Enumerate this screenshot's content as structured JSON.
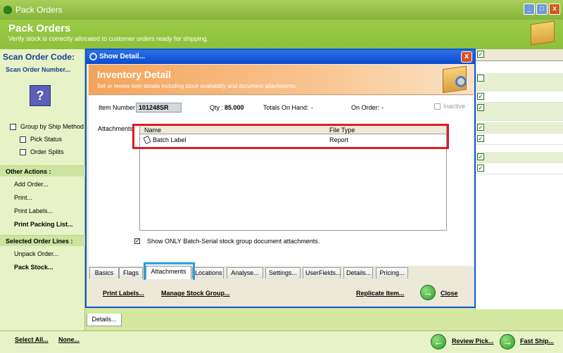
{
  "window": {
    "title": "Pack Orders",
    "buttons": {
      "minimize": "_",
      "maximize": "□",
      "close": "x"
    }
  },
  "header": {
    "title": "Pack Orders",
    "subtitle": "Verify stock is correctly allocated to customer orders ready for shipping."
  },
  "sidebar": {
    "scan_label": "Scan Order Code:",
    "scan_link": "Scan Order Number...",
    "help_glyph": "?",
    "group_by": "Group by Ship Method",
    "pick_status": "Pick Status",
    "order_splits": "Order Splits",
    "other_actions_header": "Other Actions :",
    "other_actions": [
      "Add Order...",
      "Print...",
      "Print Labels...",
      "Print Packing List..."
    ],
    "selected_header": "Selected Order Lines :",
    "selected_actions": [
      "Unpack Order...",
      "Pack Stock..."
    ]
  },
  "background_grid": {
    "check_glyph": "✓"
  },
  "details_tab": "Details...",
  "bottom_bar": {
    "select_all": "Select All...",
    "none": "None...",
    "review_pick": "Review Pick...",
    "fast_ship": "Fast Ship...",
    "arrow_left": "←",
    "arrow_right": "→"
  },
  "dialog": {
    "title": "Show Detail...",
    "close_glyph": "x",
    "banner_title": "Inventory Detail",
    "banner_sub": "Set or review item details including stock availability and document attachments.",
    "item_number_label": "Item Number",
    "item_number_value": "101248SR",
    "qty_label": "Qty :",
    "qty_value": "85.000",
    "on_hand_label": "Totals On Hand:",
    "on_hand_value": "-",
    "on_order_label": "On Order:",
    "on_order_value": "-",
    "inactive_label": "Inactive",
    "attachments_label": "Attachments",
    "attachments": {
      "columns": [
        "Name",
        "File Type"
      ],
      "rows": [
        {
          "name": "Batch Label",
          "type": "Report"
        }
      ]
    },
    "show_only_label": "Show ONLY Batch-Serial stock group document attachments.",
    "show_only_check": "✓",
    "tabs": [
      "Basics",
      "Flags",
      "Attachments",
      "Locations",
      "Analyse...",
      "Settings...",
      "UserFields...",
      "Details...",
      "Pricing..."
    ],
    "active_tab": "Attachments",
    "footer": {
      "print_labels": "Print Labels...",
      "manage_stock_group": "Manage Stock Group...",
      "replicate_item": "Replicate Item...",
      "close": "Close",
      "close_arrow": "→"
    }
  }
}
